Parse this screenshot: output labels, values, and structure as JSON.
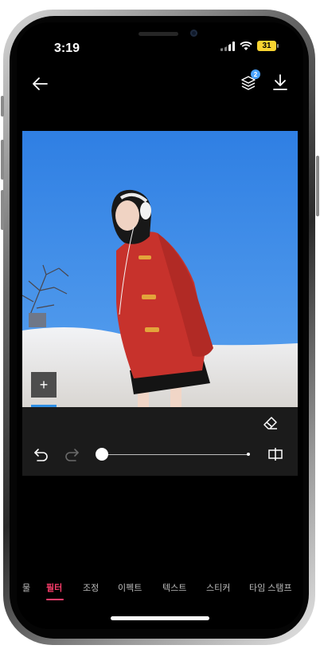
{
  "status_bar": {
    "time": "3:19",
    "battery": "31"
  },
  "toolbar": {
    "back_icon": "arrow-left-icon",
    "layers_icon": "layers-icon",
    "layers_badge": "2",
    "download_icon": "download-icon"
  },
  "photo": {
    "description_icon": "photo",
    "sky_color": "#3b86e6",
    "coat_color": "#c7322c"
  },
  "left_tools": {
    "add_label": "+",
    "confirm_icon": "check-icon",
    "accent": "#2f8fe4"
  },
  "edit_panel": {
    "slider_value": 0
  },
  "bottom_tabs": [
    {
      "label": "물"
    },
    {
      "label": "필터"
    },
    {
      "label": "조정"
    },
    {
      "label": "이펙트"
    },
    {
      "label": "텍스트"
    },
    {
      "label": "스티커"
    },
    {
      "label": "타임 스탬프"
    }
  ],
  "colors": {
    "accent": "#ff3e6c",
    "background": "#000000",
    "panel": "#1b1b1b"
  }
}
